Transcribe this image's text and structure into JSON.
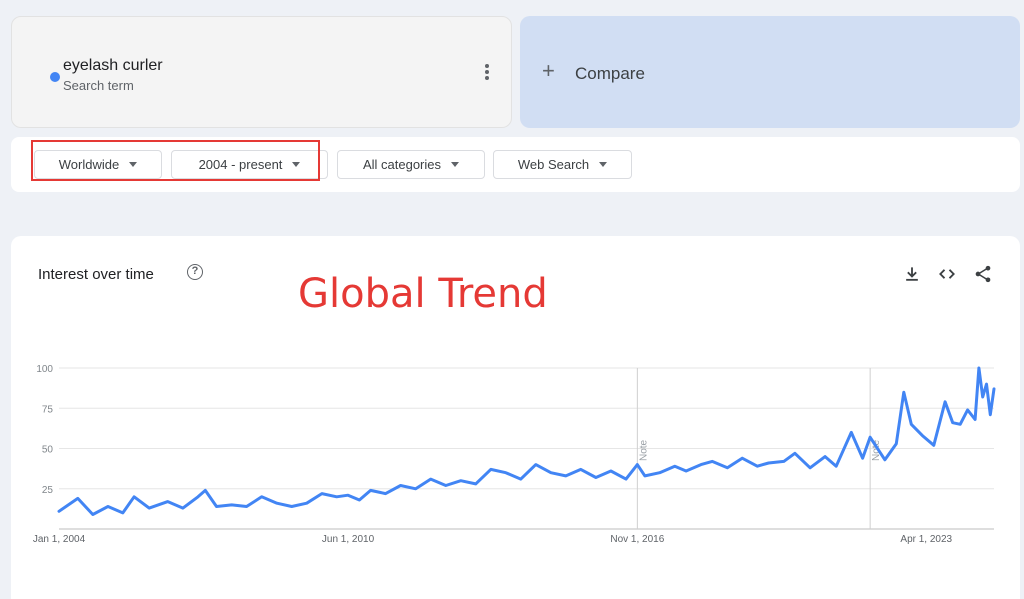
{
  "search_term": {
    "name": "eyelash curler",
    "subtitle": "Search term",
    "dot_color": "#4285f4",
    "menu_icon": "more-vert-icon"
  },
  "compare": {
    "icon": "plus-icon",
    "label": "Compare"
  },
  "filters": {
    "region": "Worldwide",
    "time_range": "2004 - present",
    "category": "All categories",
    "search_type": "Web Search"
  },
  "chart_card": {
    "title": "Interest over time",
    "help_icon": "help-circle-icon",
    "overlay_annotation": "Global Trend",
    "actions": [
      "download-icon",
      "embed-code-icon",
      "share-icon"
    ]
  },
  "chart_data": {
    "type": "line",
    "title": "Interest over time",
    "x_range": [
      "2004-01-01",
      "2024-10-01"
    ],
    "ylim": [
      0,
      100
    ],
    "y_ticks": [
      25,
      50,
      75,
      100
    ],
    "x_tick_labels": [
      {
        "date": "2004-01-01",
        "label": "Jan 1, 2004"
      },
      {
        "date": "2010-06-01",
        "label": "Jun 1, 2010"
      },
      {
        "date": "2016-11-01",
        "label": "Nov 1, 2016"
      },
      {
        "date": "2023-04-01",
        "label": "Apr 1, 2023"
      }
    ],
    "notes": [
      {
        "date": "2016-11-01",
        "label": "Note"
      },
      {
        "date": "2022-01-01",
        "label": "Note"
      }
    ],
    "grid": true,
    "legend": "none",
    "series": [
      {
        "color": "#4285f4",
        "points": [
          [
            "2004-01",
            11
          ],
          [
            "2004-06",
            19
          ],
          [
            "2004-10",
            9
          ],
          [
            "2005-02",
            14
          ],
          [
            "2005-06",
            10
          ],
          [
            "2005-09",
            20
          ],
          [
            "2006-01",
            13
          ],
          [
            "2006-06",
            17
          ],
          [
            "2006-10",
            13
          ],
          [
            "2007-02",
            20
          ],
          [
            "2007-04",
            24
          ],
          [
            "2007-07",
            14
          ],
          [
            "2007-11",
            15
          ],
          [
            "2008-03",
            14
          ],
          [
            "2008-07",
            20
          ],
          [
            "2008-11",
            16
          ],
          [
            "2009-03",
            14
          ],
          [
            "2009-07",
            16
          ],
          [
            "2009-11",
            22
          ],
          [
            "2010-03",
            20
          ],
          [
            "2010-06",
            21
          ],
          [
            "2010-09",
            18
          ],
          [
            "2010-12",
            24
          ],
          [
            "2011-04",
            22
          ],
          [
            "2011-08",
            27
          ],
          [
            "2011-12",
            25
          ],
          [
            "2012-04",
            31
          ],
          [
            "2012-08",
            27
          ],
          [
            "2012-12",
            30
          ],
          [
            "2013-04",
            28
          ],
          [
            "2013-08",
            37
          ],
          [
            "2013-12",
            35
          ],
          [
            "2014-04",
            31
          ],
          [
            "2014-08",
            40
          ],
          [
            "2014-12",
            35
          ],
          [
            "2015-04",
            33
          ],
          [
            "2015-08",
            37
          ],
          [
            "2015-12",
            32
          ],
          [
            "2016-04",
            36
          ],
          [
            "2016-08",
            31
          ],
          [
            "2016-11",
            40
          ],
          [
            "2017-01",
            33
          ],
          [
            "2017-05",
            35
          ],
          [
            "2017-09",
            39
          ],
          [
            "2017-12",
            36
          ],
          [
            "2018-04",
            40
          ],
          [
            "2018-07",
            42
          ],
          [
            "2018-11",
            38
          ],
          [
            "2019-03",
            44
          ],
          [
            "2019-07",
            39
          ],
          [
            "2019-10",
            41
          ],
          [
            "2020-02",
            42
          ],
          [
            "2020-05",
            47
          ],
          [
            "2020-09",
            38
          ],
          [
            "2021-01",
            45
          ],
          [
            "2021-04",
            39
          ],
          [
            "2021-08",
            60
          ],
          [
            "2021-11",
            44
          ],
          [
            "2022-01",
            57
          ],
          [
            "2022-05",
            43
          ],
          [
            "2022-08",
            53
          ],
          [
            "2022-10",
            85
          ],
          [
            "2022-12",
            65
          ],
          [
            "2023-03",
            58
          ],
          [
            "2023-06",
            52
          ],
          [
            "2023-09",
            79
          ],
          [
            "2023-11",
            66
          ],
          [
            "2024-01",
            65
          ],
          [
            "2024-03",
            74
          ],
          [
            "2024-05",
            68
          ],
          [
            "2024-06",
            100
          ],
          [
            "2024-07",
            82
          ],
          [
            "2024-08",
            90
          ],
          [
            "2024-09",
            71
          ],
          [
            "2024-10",
            87
          ]
        ]
      }
    ]
  }
}
